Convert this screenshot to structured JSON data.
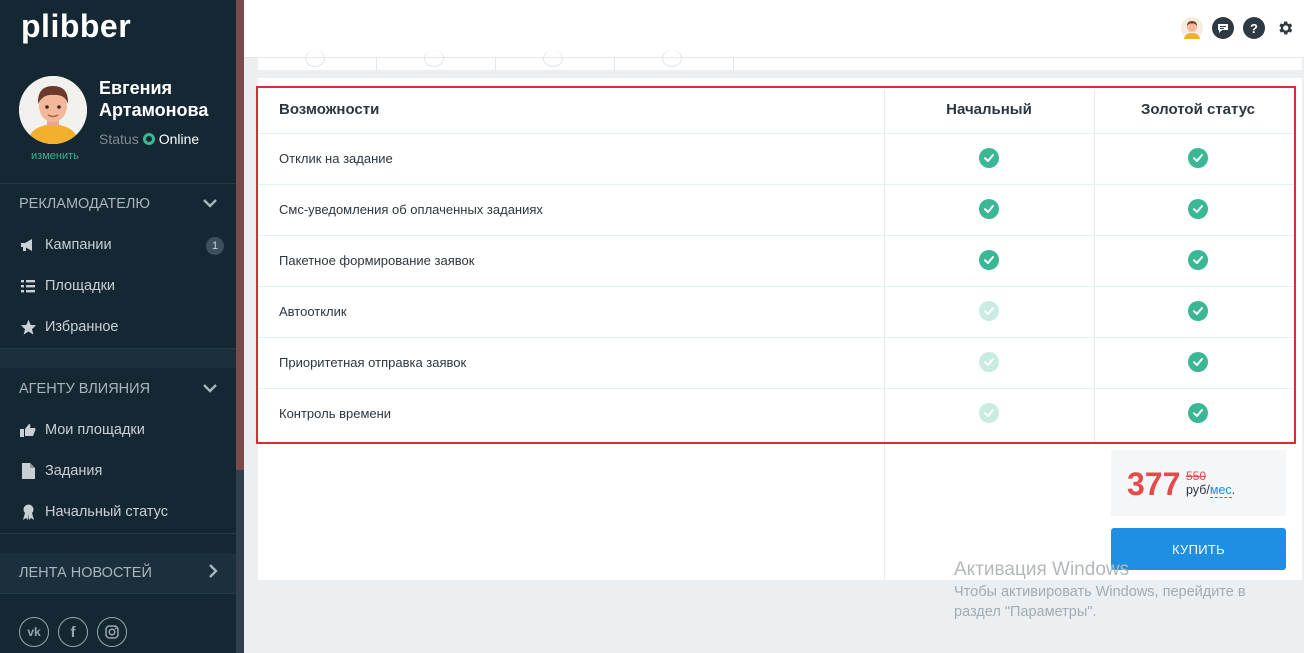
{
  "app": {
    "logo": "plibber"
  },
  "user": {
    "first_name": "Евгения",
    "last_name": "Артамонова",
    "status_label": "Status",
    "status_value": "Online",
    "change_link": "изменить"
  },
  "sidebar": {
    "section_advertiser": "РЕКЛАМОДАТЕЛЮ",
    "advertiser_items": [
      {
        "label": "Кампании",
        "icon": "megaphone-icon",
        "badge": "1"
      },
      {
        "label": "Площадки",
        "icon": "list-icon"
      },
      {
        "label": "Избранное",
        "icon": "star-icon"
      }
    ],
    "section_agent": "АГЕНТУ ВЛИЯНИЯ",
    "agent_items": [
      {
        "label": "Мои площадки",
        "icon": "thumbs-up-icon"
      },
      {
        "label": "Задания",
        "icon": "document-icon"
      },
      {
        "label": "Начальный статус",
        "icon": "award-icon"
      }
    ],
    "section_news": "ЛЕНТА НОВОСТЕЙ",
    "socials": [
      "vk-icon",
      "facebook-icon",
      "instagram-icon"
    ]
  },
  "table": {
    "header_feature": "Возможности",
    "header_basic": "Начальный",
    "header_gold": "Золотой статус",
    "rows": [
      {
        "feature": "Отклик на задание",
        "basic": true,
        "gold": true
      },
      {
        "feature": "Смс-уведомления об оплаченных заданиях",
        "basic": true,
        "gold": true
      },
      {
        "feature": "Пакетное формирование заявок",
        "basic": true,
        "gold": true
      },
      {
        "feature": "Автоотклик",
        "basic": false,
        "gold": true
      },
      {
        "feature": "Приоритетная отправка заявок",
        "basic": false,
        "gold": true
      },
      {
        "feature": "Контроль времени",
        "basic": false,
        "gold": true
      }
    ]
  },
  "pricing": {
    "price": "377",
    "old_price": "550",
    "currency": "руб/",
    "period": "мес",
    "period_suffix": ".",
    "buy_label": "КУПИТЬ"
  },
  "watermark": {
    "title": "Активация Windows",
    "line1": "Чтобы активировать Windows, перейдите в",
    "line2": "раздел \"Параметры\"."
  },
  "colors": {
    "check_on": "#3ab795",
    "check_off": "#c8ebe2",
    "highlight": "#d32f35",
    "accent_blue": "#1e8fe1",
    "price_red": "#e84a4a"
  }
}
